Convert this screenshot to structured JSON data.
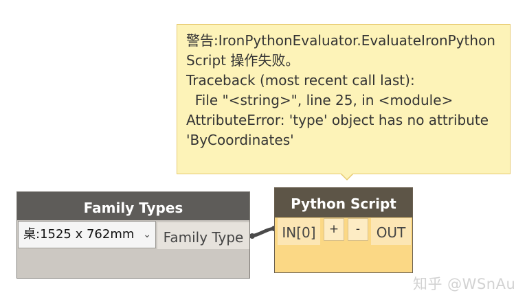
{
  "warning": {
    "text": "警告:IronPythonEvaluator.EvaluateIronPythonScript 操作失败。\nTraceback (most recent call last):\n  File \"<string>\", line 25, in <module>\nAttributeError: 'type' object has no attribute 'ByCoordinates'"
  },
  "family_types_node": {
    "title": "Family Types",
    "selected_option": "桌:1525 x 762mm",
    "output_port": "Family Type"
  },
  "python_node": {
    "title": "Python Script",
    "input_port": "IN[0]",
    "add_label": "+",
    "remove_label": "-",
    "output_port": "OUT"
  },
  "watermark": {
    "text": "知乎 @WSnAu"
  },
  "colors": {
    "warning_bg": "#fdf3b8",
    "family_node_header": "#5e5c59",
    "python_node_header": "#5d5547",
    "python_node_body": "#fbd885"
  }
}
